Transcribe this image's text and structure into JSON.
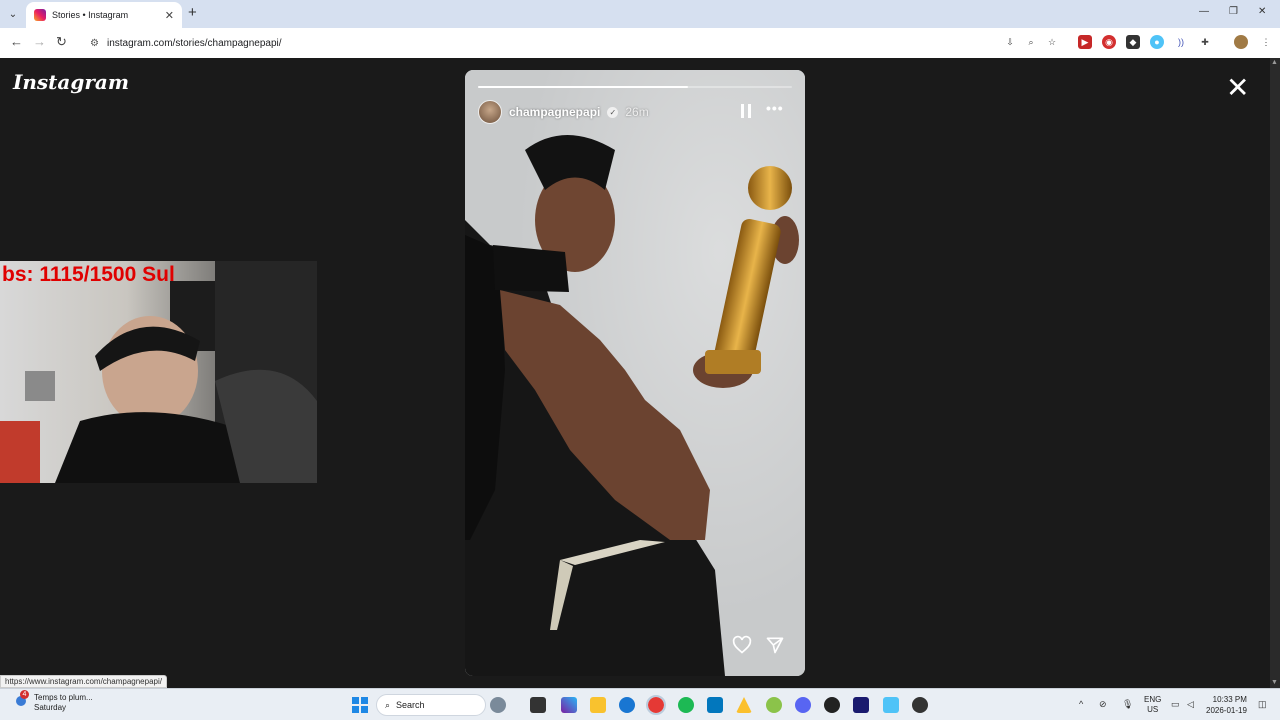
{
  "browser": {
    "tab_title": "Stories • Instagram",
    "tab_close": "✕",
    "new_tab": "+",
    "url": "instagram.com/stories/champagnepapi/",
    "window_controls": [
      "—",
      "❐",
      "✕"
    ]
  },
  "instagram": {
    "logo_text": "Instagram",
    "close_glyph": "✕",
    "story": {
      "username": "champagnepapi",
      "verified": true,
      "time_ago": "26m",
      "progress": 0.67
    }
  },
  "overlay": {
    "sub_goal_text": "bs: 1115/1500  Sul"
  },
  "status_bar": {
    "hover_url": "https://www.instagram.com/champagnepapi/"
  },
  "taskbar": {
    "weather_badge": "4",
    "weather_title": "Temps to plum...",
    "weather_sub": "Saturday",
    "search_label": "Search",
    "lang_top": "ENG",
    "lang_bottom": "US",
    "time": "10:33 PM",
    "date": "2026-01-19"
  },
  "colors": {
    "page_bg": "#1a1a1a",
    "sub_goal": "#e00000",
    "chrome_tabstrip": "#d6e0f0"
  }
}
